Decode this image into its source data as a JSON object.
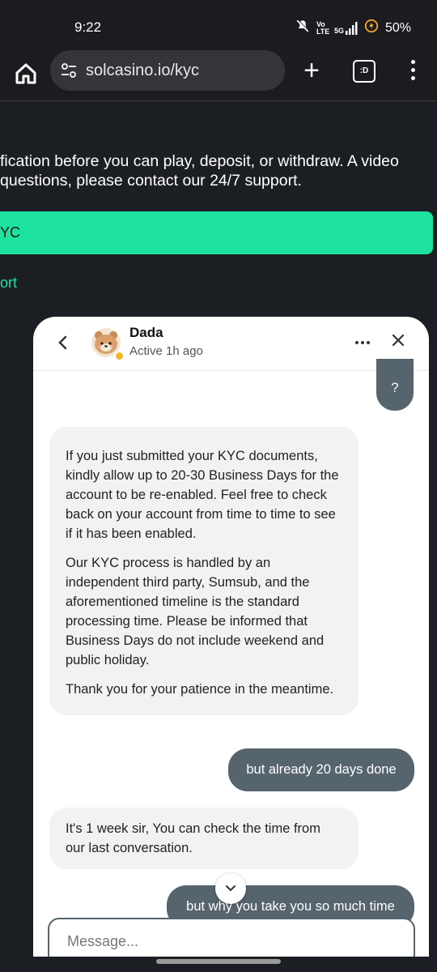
{
  "status_bar": {
    "time": "9:22",
    "volte": "Vo LTE",
    "network": "5G",
    "battery": "50%"
  },
  "browser": {
    "url": "solcasino.io/kyc",
    "tab_icon_label": ":D"
  },
  "page": {
    "text_line1": "fication before you can play, deposit, or withdraw. A video",
    "text_line2": "questions, please contact our 24/7 support.",
    "kyc_button": "YC",
    "support_link": "ort"
  },
  "chat": {
    "agent_name": "Dada",
    "agent_status": "Active 1h ago",
    "messages": [
      {
        "from": "user",
        "text": "?"
      },
      {
        "from": "agent",
        "paragraphs": [
          "If you just submitted your KYC documents, kindly allow up to 20-30 Business Days for the account to be re-enabled. Feel free to check back on your account from time to time to see if it has been enabled.",
          "Our KYC process is handled by an independent third party, Sumsub, and the aforementioned timeline is the standard processing time. Please be informed that Business Days do not include weekend and public holiday.",
          "Thank you for your patience in the meantime."
        ]
      },
      {
        "from": "user",
        "text": "but already 20 days done"
      },
      {
        "from": "agent",
        "text": "It's 1 week sir, You can check the time from our last conversation."
      },
      {
        "from": "user",
        "text": "but why you take you so much time"
      }
    ],
    "input_placeholder": "Message..."
  },
  "colors": {
    "accent": "#1ee3a0",
    "user_bubble": "#56646e",
    "agent_bubble": "#f2f2f2",
    "status_dot": "#f2b826"
  }
}
